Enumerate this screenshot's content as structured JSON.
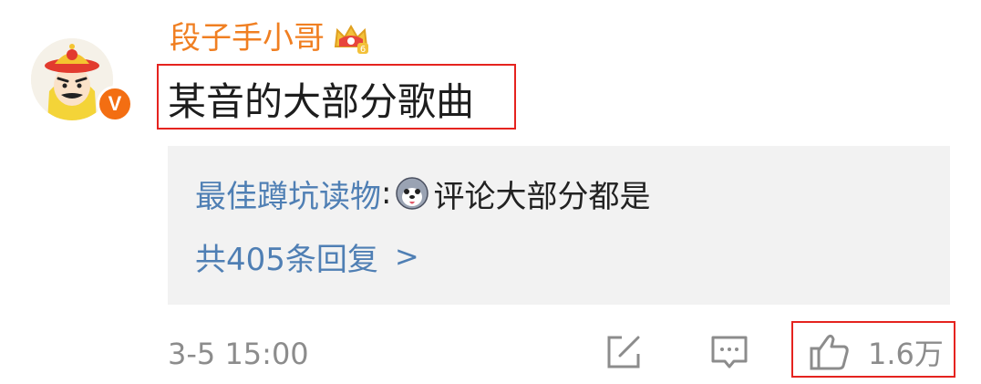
{
  "post": {
    "username": "段子手小哥",
    "verified_badge": "V",
    "comment_text": "某音的大部分歌曲",
    "timestamp": "3-5 15:00",
    "likes": "1.6万"
  },
  "reply_preview": {
    "author": "最佳蹲坑读物",
    "separator": ":",
    "text": "评论大部分都是",
    "more_label": "共405条回复",
    "more_chevron": ">"
  },
  "icons": {
    "share": "edit-share-icon",
    "comment": "comment-icon",
    "like": "thumbs-up-icon",
    "crown": "crown-vip-icon",
    "emoji": "dog-emoji-icon"
  },
  "colors": {
    "username": "#f07f22",
    "link": "#4f7fb4",
    "highlight_border": "#e5231f",
    "muted": "#8c8c8c",
    "panel_bg": "#f2f2f2",
    "badge": "#f36e12"
  }
}
